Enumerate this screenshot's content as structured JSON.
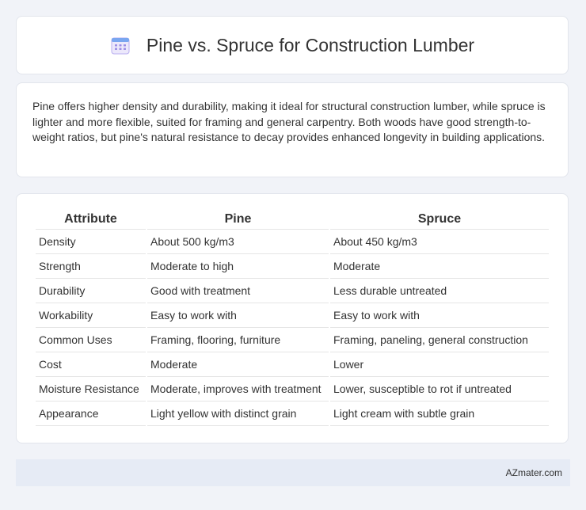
{
  "header": {
    "title": "Pine vs. Spruce for Construction Lumber",
    "icon": "calendar-icon"
  },
  "summary": {
    "text": "Pine offers higher density and durability, making it ideal for structural construction lumber, while spruce is lighter and more flexible, suited for framing and general carpentry. Both woods have good strength-to-weight ratios, but pine's natural resistance to decay provides enhanced longevity in building applications."
  },
  "table": {
    "headers": [
      "Attribute",
      "Pine",
      "Spruce"
    ],
    "rows": [
      [
        "Density",
        "About 500 kg/m3",
        "About 450 kg/m3"
      ],
      [
        "Strength",
        "Moderate to high",
        "Moderate"
      ],
      [
        "Durability",
        "Good with treatment",
        "Less durable untreated"
      ],
      [
        "Workability",
        "Easy to work with",
        "Easy to work with"
      ],
      [
        "Common Uses",
        "Framing, flooring, furniture",
        "Framing, paneling, general construction"
      ],
      [
        "Cost",
        "Moderate",
        "Lower"
      ],
      [
        "Moisture Resistance",
        "Moderate, improves with treatment",
        "Lower, susceptible to rot if untreated"
      ],
      [
        "Appearance",
        "Light yellow with distinct grain",
        "Light cream with subtle grain"
      ]
    ]
  },
  "footer": {
    "brand": "AZmater.com"
  },
  "colors": {
    "background": "#f1f3f8",
    "card": "#ffffff",
    "footer": "#e6ebf5",
    "icon_accent": "#8a7bd8"
  }
}
